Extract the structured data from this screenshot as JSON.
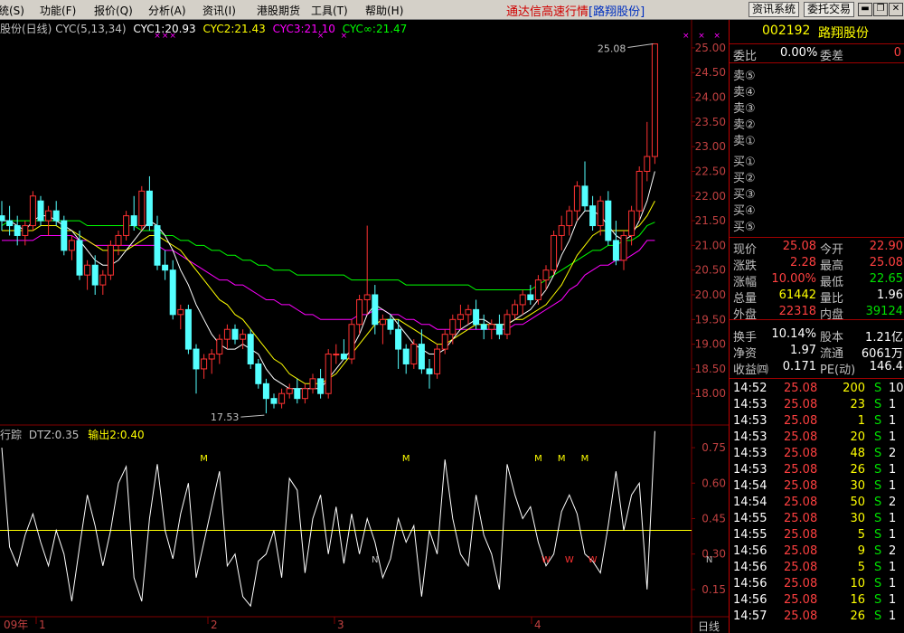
{
  "menu": {
    "items": [
      "统(S)",
      "功能(F)",
      "报价(Q)",
      "分析(A)",
      "资讯(I)",
      "港股期货",
      "工具(T)",
      "帮助(H)"
    ],
    "app_title": "通达信高速行情",
    "app_stock": "[路翔股份]",
    "btn_info": "资讯系统",
    "btn_trade": "委托交易"
  },
  "chart": {
    "title_fragment": "股份(日线)",
    "indicator_name": "CYC(5,13,34)",
    "cyc1": "CYC1:20.93",
    "cyc2": "CYC2:21.43",
    "cyc3": "CYC3:21.10",
    "cycinf": "CYC∞:21.47",
    "high_label": "25.08",
    "low_label": "17.53",
    "sub_title": "行踪",
    "dtz": "DTZ:0.35",
    "out2": "输出2:0.40",
    "period_label": "日线",
    "x_labels": [
      "09年",
      "1",
      "2",
      "3",
      "4"
    ],
    "y_labels": [
      "25.00",
      "24.50",
      "24.00",
      "23.50",
      "23.00",
      "22.50",
      "22.00",
      "21.50",
      "21.00",
      "20.50",
      "20.00",
      "19.50",
      "19.00",
      "18.50",
      "18.00"
    ],
    "sub_y_labels": [
      "0.75",
      "0.60",
      "0.45",
      "0.30",
      "0.15"
    ],
    "colors": {
      "up": "#ff3232",
      "down": "#54ffff",
      "cyc1": "#ffffff",
      "cyc2": "#ffff00",
      "cyc3": "#ff00ff",
      "cycinf": "#00ff00",
      "grid": "#800000"
    }
  },
  "chart_data": {
    "type": "candlestick",
    "ylim": [
      17.4,
      25.2
    ],
    "sub_ylim": [
      0.05,
      0.8
    ],
    "sub_ref_line": 0.4,
    "candles": [
      [
        21.6,
        21.9,
        21.3,
        21.5
      ],
      [
        21.5,
        21.8,
        21.2,
        21.4
      ],
      [
        21.4,
        21.6,
        21.0,
        21.2
      ],
      [
        21.2,
        21.5,
        21.0,
        21.4
      ],
      [
        21.4,
        22.1,
        21.3,
        22.0
      ],
      [
        21.9,
        22.0,
        21.4,
        21.5
      ],
      [
        21.5,
        21.8,
        21.2,
        21.7
      ],
      [
        21.7,
        21.9,
        21.4,
        21.5
      ],
      [
        21.5,
        21.6,
        20.8,
        20.9
      ],
      [
        20.9,
        21.2,
        20.7,
        21.1
      ],
      [
        21.1,
        21.3,
        20.3,
        20.4
      ],
      [
        20.4,
        20.7,
        20.1,
        20.6
      ],
      [
        20.6,
        20.8,
        20.0,
        20.2
      ],
      [
        20.2,
        20.5,
        20.0,
        20.4
      ],
      [
        20.4,
        21.1,
        20.3,
        21.0
      ],
      [
        21.0,
        21.3,
        20.8,
        21.2
      ],
      [
        21.2,
        21.7,
        21.1,
        21.6
      ],
      [
        21.6,
        22.0,
        21.3,
        21.4
      ],
      [
        21.4,
        22.2,
        21.3,
        22.1
      ],
      [
        22.1,
        22.4,
        21.3,
        21.4
      ],
      [
        21.4,
        21.6,
        20.5,
        20.6
      ],
      [
        20.6,
        20.9,
        20.3,
        20.5
      ],
      [
        20.5,
        20.7,
        19.5,
        19.6
      ],
      [
        19.6,
        19.8,
        19.3,
        19.7
      ],
      [
        19.7,
        19.8,
        18.8,
        18.9
      ],
      [
        18.9,
        19.0,
        18.0,
        18.5
      ],
      [
        18.5,
        18.8,
        18.3,
        18.7
      ],
      [
        18.7,
        18.9,
        18.4,
        18.8
      ],
      [
        18.8,
        19.2,
        18.6,
        19.1
      ],
      [
        19.1,
        19.4,
        18.9,
        19.3
      ],
      [
        19.3,
        19.4,
        19.0,
        19.1
      ],
      [
        19.1,
        19.3,
        18.9,
        19.2
      ],
      [
        19.2,
        19.3,
        18.5,
        18.6
      ],
      [
        18.6,
        18.7,
        18.1,
        18.2
      ],
      [
        18.2,
        18.3,
        17.6,
        17.9
      ],
      [
        17.9,
        18.0,
        17.7,
        17.8
      ],
      [
        17.8,
        18.1,
        17.7,
        18.0
      ],
      [
        18.0,
        18.2,
        17.9,
        18.1
      ],
      [
        18.1,
        18.3,
        17.8,
        17.9
      ],
      [
        17.9,
        18.2,
        17.8,
        18.1
      ],
      [
        18.1,
        18.4,
        18.0,
        18.3
      ],
      [
        18.3,
        18.5,
        17.9,
        18.0
      ],
      [
        18.0,
        18.9,
        17.9,
        18.8
      ],
      [
        18.8,
        19.0,
        18.6,
        18.8
      ],
      [
        18.8,
        19.1,
        18.7,
        18.7
      ],
      [
        18.7,
        19.5,
        18.6,
        19.4
      ],
      [
        19.4,
        20.0,
        19.2,
        19.9
      ],
      [
        19.9,
        21.4,
        19.6,
        20.0
      ],
      [
        20.0,
        20.2,
        19.2,
        19.4
      ],
      [
        19.4,
        19.6,
        19.0,
        19.5
      ],
      [
        19.5,
        19.6,
        19.2,
        19.3
      ],
      [
        19.3,
        19.5,
        18.5,
        18.9
      ],
      [
        18.9,
        19.0,
        18.4,
        18.6
      ],
      [
        18.6,
        19.1,
        18.5,
        19.0
      ],
      [
        19.0,
        19.3,
        18.4,
        18.5
      ],
      [
        18.5,
        18.7,
        18.1,
        18.4
      ],
      [
        18.4,
        19.0,
        18.3,
        18.9
      ],
      [
        18.9,
        19.3,
        18.8,
        19.2
      ],
      [
        19.2,
        19.6,
        19.0,
        19.5
      ],
      [
        19.5,
        19.8,
        19.3,
        19.6
      ],
      [
        19.6,
        19.8,
        19.4,
        19.7
      ],
      [
        19.7,
        19.9,
        19.3,
        19.4
      ],
      [
        19.4,
        19.6,
        19.1,
        19.3
      ],
      [
        19.3,
        19.5,
        19.1,
        19.4
      ],
      [
        19.4,
        19.6,
        19.1,
        19.2
      ],
      [
        19.2,
        19.7,
        19.1,
        19.6
      ],
      [
        19.6,
        19.9,
        19.5,
        19.8
      ],
      [
        19.8,
        20.1,
        19.6,
        20.0
      ],
      [
        20.0,
        20.2,
        19.8,
        19.9
      ],
      [
        19.9,
        20.4,
        19.8,
        20.3
      ],
      [
        20.3,
        20.6,
        20.1,
        20.5
      ],
      [
        20.5,
        21.3,
        20.4,
        21.2
      ],
      [
        21.2,
        21.6,
        20.9,
        21.4
      ],
      [
        21.4,
        21.8,
        21.2,
        21.7
      ],
      [
        21.7,
        22.3,
        21.5,
        22.2
      ],
      [
        22.2,
        22.7,
        21.7,
        21.8
      ],
      [
        21.8,
        22.0,
        21.3,
        21.4
      ],
      [
        21.4,
        22.0,
        21.2,
        21.9
      ],
      [
        21.9,
        22.1,
        21.0,
        21.1
      ],
      [
        21.1,
        21.5,
        20.6,
        20.7
      ],
      [
        20.7,
        21.3,
        20.5,
        21.2
      ],
      [
        21.2,
        21.8,
        21.0,
        21.7
      ],
      [
        21.7,
        22.6,
        21.5,
        22.5
      ],
      [
        22.5,
        23.5,
        22.3,
        22.8
      ],
      [
        22.8,
        25.08,
        22.65,
        25.08
      ]
    ],
    "cyc1": [
      21.5,
      21.5,
      21.4,
      21.3,
      21.5,
      21.6,
      21.6,
      21.5,
      21.4,
      21.3,
      21.1,
      20.9,
      20.7,
      20.6,
      20.6,
      20.7,
      20.9,
      21.1,
      21.3,
      21.5,
      21.4,
      21.2,
      20.9,
      20.5,
      20.2,
      19.8,
      19.5,
      19.2,
      19.0,
      18.9,
      18.9,
      19.0,
      18.9,
      18.8,
      18.5,
      18.3,
      18.2,
      18.1,
      18.1,
      18.1,
      18.1,
      18.1,
      18.3,
      18.5,
      18.7,
      18.9,
      19.2,
      19.6,
      19.8,
      19.7,
      19.6,
      19.4,
      19.2,
      19.0,
      18.9,
      18.8,
      18.8,
      18.9,
      19.1,
      19.3,
      19.4,
      19.5,
      19.5,
      19.4,
      19.4,
      19.4,
      19.5,
      19.6,
      19.7,
      19.9,
      20.1,
      20.4,
      20.8,
      21.1,
      21.5,
      21.7,
      21.7,
      21.6,
      21.4,
      21.2,
      21.1,
      21.2,
      21.5,
      21.9,
      22.5
    ],
    "cyc2": [
      21.3,
      21.3,
      21.3,
      21.3,
      21.3,
      21.4,
      21.4,
      21.4,
      21.3,
      21.3,
      21.2,
      21.1,
      21.0,
      20.9,
      20.9,
      20.9,
      20.9,
      21.0,
      21.1,
      21.2,
      21.2,
      21.1,
      21.0,
      20.9,
      20.7,
      20.5,
      20.3,
      20.1,
      19.9,
      19.8,
      19.6,
      19.5,
      19.3,
      19.1,
      18.9,
      18.7,
      18.6,
      18.4,
      18.3,
      18.2,
      18.2,
      18.2,
      18.3,
      18.4,
      18.6,
      18.8,
      19.0,
      19.2,
      19.4,
      19.5,
      19.5,
      19.5,
      19.4,
      19.3,
      19.2,
      19.1,
      19.0,
      19.0,
      19.1,
      19.2,
      19.3,
      19.4,
      19.4,
      19.4,
      19.4,
      19.4,
      19.5,
      19.5,
      19.6,
      19.7,
      19.8,
      20.0,
      20.2,
      20.5,
      20.8,
      21.0,
      21.2,
      21.3,
      21.3,
      21.3,
      21.3,
      21.3,
      21.4,
      21.6,
      21.9
    ],
    "cyc3": [
      21.1,
      21.1,
      21.1,
      21.1,
      21.1,
      21.2,
      21.2,
      21.2,
      21.2,
      21.2,
      21.1,
      21.1,
      21.0,
      21.0,
      21.0,
      21.0,
      21.0,
      21.0,
      21.0,
      21.0,
      21.0,
      20.9,
      20.9,
      20.8,
      20.7,
      20.6,
      20.5,
      20.4,
      20.3,
      20.3,
      20.2,
      20.2,
      20.1,
      20.0,
      19.9,
      19.9,
      19.8,
      19.8,
      19.7,
      19.6,
      19.6,
      19.5,
      19.5,
      19.5,
      19.5,
      19.5,
      19.6,
      19.6,
      19.7,
      19.7,
      19.6,
      19.6,
      19.5,
      19.5,
      19.4,
      19.4,
      19.3,
      19.3,
      19.3,
      19.3,
      19.3,
      19.3,
      19.3,
      19.3,
      19.3,
      19.3,
      19.4,
      19.4,
      19.5,
      19.6,
      19.7,
      19.8,
      19.9,
      20.1,
      20.2,
      20.4,
      20.5,
      20.6,
      20.6,
      20.7,
      20.7,
      20.8,
      20.9,
      21.1,
      21.1
    ],
    "cycinf": [
      21.4,
      21.5,
      21.5,
      21.5,
      21.5,
      21.5,
      21.5,
      21.5,
      21.5,
      21.5,
      21.5,
      21.4,
      21.4,
      21.4,
      21.4,
      21.4,
      21.4,
      21.4,
      21.3,
      21.3,
      21.3,
      21.2,
      21.2,
      21.1,
      21.1,
      21.0,
      21.0,
      20.9,
      20.9,
      20.8,
      20.8,
      20.7,
      20.7,
      20.6,
      20.6,
      20.5,
      20.5,
      20.5,
      20.4,
      20.4,
      20.4,
      20.4,
      20.4,
      20.4,
      20.4,
      20.3,
      20.3,
      20.3,
      20.3,
      20.3,
      20.3,
      20.3,
      20.2,
      20.2,
      20.2,
      20.2,
      20.2,
      20.2,
      20.2,
      20.2,
      20.2,
      20.1,
      20.1,
      20.1,
      20.1,
      20.1,
      20.1,
      20.1,
      20.1,
      20.2,
      20.3,
      20.4,
      20.5,
      20.6,
      20.7,
      20.8,
      20.9,
      20.9,
      21.0,
      21.0,
      21.1,
      21.1,
      21.2,
      21.4,
      21.47
    ],
    "sub_values": [
      0.75,
      0.33,
      0.25,
      0.38,
      0.47,
      0.35,
      0.25,
      0.4,
      0.3,
      0.1,
      0.33,
      0.55,
      0.42,
      0.25,
      0.4,
      0.6,
      0.67,
      0.2,
      0.1,
      0.45,
      0.68,
      0.4,
      0.28,
      0.47,
      0.6,
      0.2,
      0.35,
      0.5,
      0.65,
      0.25,
      0.3,
      0.12,
      0.08,
      0.27,
      0.3,
      0.4,
      0.2,
      0.62,
      0.57,
      0.22,
      0.45,
      0.55,
      0.3,
      0.5,
      0.26,
      0.47,
      0.3,
      0.45,
      0.35,
      0.2,
      0.28,
      0.45,
      0.35,
      0.42,
      0.12,
      0.4,
      0.3,
      0.7,
      0.45,
      0.3,
      0.25,
      0.55,
      0.38,
      0.3,
      0.15,
      0.68,
      0.55,
      0.45,
      0.5,
      0.35,
      0.25,
      0.3,
      0.48,
      0.55,
      0.47,
      0.3,
      0.27,
      0.22,
      0.42,
      0.65,
      0.4,
      0.55,
      0.6,
      0.15,
      0.82
    ],
    "m_markers": [
      26,
      52,
      69,
      72,
      75,
      95
    ],
    "n_markers": [
      48,
      91
    ],
    "w_markers": [
      70,
      73,
      76,
      97
    ],
    "x_markers": [
      20,
      21,
      22,
      41,
      44,
      88,
      90,
      92
    ]
  },
  "quote": {
    "code": "002192",
    "name": "路翔股份",
    "weibi_label": "委比",
    "weibi": "0.00%",
    "weicha_label": "委差",
    "weicha": "0",
    "sell": [
      "卖⑤",
      "卖④",
      "卖③",
      "卖②",
      "卖①"
    ],
    "buy": [
      "买①",
      "买②",
      "买③",
      "买④",
      "买⑤"
    ],
    "stats": [
      {
        "l1": "现价",
        "v1": "25.08",
        "c1": "r",
        "l2": "今开",
        "v2": "22.90",
        "c2": "r"
      },
      {
        "l1": "涨跌",
        "v1": "2.28",
        "c1": "r",
        "l2": "最高",
        "v2": "25.08",
        "c2": "r"
      },
      {
        "l1": "涨幅",
        "v1": "10.00%",
        "c1": "r",
        "l2": "最低",
        "v2": "22.65",
        "c2": "g"
      },
      {
        "l1": "总量",
        "v1": "61442",
        "c1": "y",
        "l2": "量比",
        "v2": "1.96",
        "c2": "w"
      },
      {
        "l1": "外盘",
        "v1": "22318",
        "c1": "r",
        "l2": "内盘",
        "v2": "39124",
        "c2": "g"
      }
    ],
    "stats2": [
      {
        "l1": "换手",
        "v1": "10.14%",
        "c1": "w",
        "l2": "股本",
        "v2": "1.21亿",
        "c2": "w"
      },
      {
        "l1": "净资",
        "v1": "1.97",
        "c1": "w",
        "l2": "流通",
        "v2": "6061万",
        "c2": "w"
      },
      {
        "l1": "收益㈣",
        "v1": "0.171",
        "c1": "w",
        "l2": "PE(动)",
        "v2": "146.4",
        "c2": "w"
      }
    ],
    "ticks": [
      {
        "t": "14:52",
        "p": "25.08",
        "v": "200",
        "s": "S",
        "n": "10"
      },
      {
        "t": "14:53",
        "p": "25.08",
        "v": "23",
        "s": "S",
        "n": "1"
      },
      {
        "t": "14:53",
        "p": "25.08",
        "v": "1",
        "s": "S",
        "n": "1"
      },
      {
        "t": "14:53",
        "p": "25.08",
        "v": "20",
        "s": "S",
        "n": "1"
      },
      {
        "t": "14:53",
        "p": "25.08",
        "v": "48",
        "s": "S",
        "n": "2"
      },
      {
        "t": "14:53",
        "p": "25.08",
        "v": "26",
        "s": "S",
        "n": "1"
      },
      {
        "t": "14:54",
        "p": "25.08",
        "v": "30",
        "s": "S",
        "n": "1"
      },
      {
        "t": "14:54",
        "p": "25.08",
        "v": "50",
        "s": "S",
        "n": "2"
      },
      {
        "t": "14:55",
        "p": "25.08",
        "v": "30",
        "s": "S",
        "n": "1"
      },
      {
        "t": "14:55",
        "p": "25.08",
        "v": "5",
        "s": "S",
        "n": "1"
      },
      {
        "t": "14:56",
        "p": "25.08",
        "v": "9",
        "s": "S",
        "n": "2"
      },
      {
        "t": "14:56",
        "p": "25.08",
        "v": "5",
        "s": "S",
        "n": "1"
      },
      {
        "t": "14:56",
        "p": "25.08",
        "v": "10",
        "s": "S",
        "n": "1"
      },
      {
        "t": "14:56",
        "p": "25.08",
        "v": "16",
        "s": "S",
        "n": "1"
      },
      {
        "t": "14:57",
        "p": "25.08",
        "v": "26",
        "s": "S",
        "n": "1"
      }
    ]
  }
}
